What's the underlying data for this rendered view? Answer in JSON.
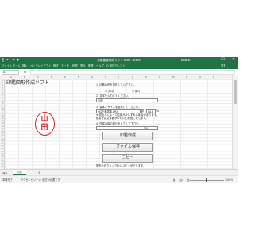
{
  "window": {
    "quick_access": "⎘ ↶ ↷ ▾",
    "title": "印鑑画像作成ソフト.xlsm - Excel",
    "user": "taka.sh",
    "minimize": "—",
    "maximize": "☐",
    "close": "✕"
  },
  "ribbon": {
    "tabs": [
      "ファイル",
      "ホーム",
      "挿入",
      "ページレイアウト",
      "数式",
      "データ",
      "校閲",
      "表示",
      "開発",
      "ヘルプ",
      "Q 操作アシスト",
      "共有"
    ]
  },
  "formula_bar": {
    "name_box": "A1",
    "fx": "fx",
    "value": ""
  },
  "columns": [
    "A",
    "B",
    "C",
    "D",
    "E",
    "F",
    "G",
    "H",
    "I",
    "J",
    "K",
    "L",
    "M",
    "N",
    "O",
    "P"
  ],
  "rows": [
    "1",
    "2",
    "3",
    "4",
    "5",
    "6",
    "7",
    "8",
    "9",
    "10",
    "11",
    "12",
    "13",
    "14",
    "15",
    "16",
    "17",
    "18",
    "19",
    "20",
    "21",
    "22",
    "23",
    "24",
    "25",
    "26",
    "27",
    "28",
    "29",
    "30",
    "31",
    "32",
    "33",
    "34",
    "35"
  ],
  "app": {
    "name": "印鑑図形作成ソフト"
  },
  "stamp": {
    "char1": "山",
    "char2": "田",
    "color": "#d2232a"
  },
  "form": {
    "q1": "1. 印鑑の形を選択してください。",
    "radio1": "○ 丸印",
    "radio2": "○ 角印",
    "q2": "2. 文字を入力してください。",
    "text_value": "山田",
    "q3": "3. 書体とサイズを選択してください。",
    "font_value": "HG正楷書体-PRO",
    "size_value": "10.5",
    "size_unit": "%",
    "q3_note1": "※ 見出しによって位置が少しずれる場合があります。",
    "q3_note2": "縦書きは文字数が少ないと縦長になります。",
    "q4": "4. 作成の幅の単位を入力して下さい。",
    "width_value": "30",
    "btn_create": "印鑑作成",
    "btn_save": "ファイル保存",
    "btn_copy": "コピー",
    "footer_note": "図形を右クリックからコピーができます。"
  },
  "sheet_tabs": {
    "nav": "◀ ▶",
    "active": "印鑑",
    "add": "⊕"
  },
  "status": {
    "ready": "準備完了",
    "accessibility": "アクセシビリティ: 検討が必要です",
    "views": "▦ ▤ ▥",
    "zoom": "100%"
  }
}
